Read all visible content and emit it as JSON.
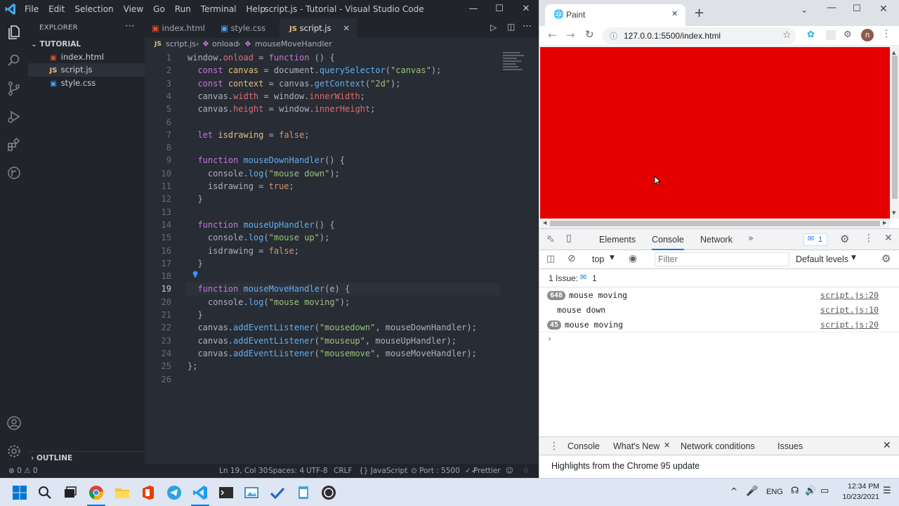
{
  "vscode": {
    "title": "script.js - Tutorial - Visual Studio Code",
    "menu": [
      "File",
      "Edit",
      "Selection",
      "View",
      "Go",
      "Run",
      "Terminal",
      "Help"
    ],
    "explorer": {
      "header": "EXPLORER",
      "folder": "TUTORIAL",
      "files": [
        "index.html",
        "script.js",
        "style.css"
      ],
      "outline": "OUTLINE"
    },
    "tabs": [
      "index.html",
      "style.css",
      "script.js"
    ],
    "breadcrumb": [
      "script.js",
      "onload",
      "mouseMoveHandler"
    ],
    "lines": [
      "window.onload = function () {",
      "  const canvas = document.querySelector(\"canvas\");",
      "  const context = canvas.getContext(\"2d\");",
      "  canvas.width = window.innerWidth;",
      "  canvas.height = window.innerHeight;",
      "",
      "  let isdrawing = false;",
      "",
      "  function mouseDownHandler() {",
      "    console.log(\"mouse down\");",
      "    isdrawing = true;",
      "  }",
      "",
      "  function mouseUpHandler() {",
      "    console.log(\"mouse up\");",
      "    isdrawing = false;",
      "  }",
      "",
      "  function mouseMoveHandler(e) {",
      "    console.log(\"mouse moving\");",
      "  }",
      "  canvas.addEventListener(\"mousedown\", mouseDownHandler);",
      "  canvas.addEventListener(\"mouseup\", mouseUpHandler);",
      "  canvas.addEventListener(\"mousemove\", mouseMoveHandler);",
      "};",
      ""
    ],
    "current_line": 19,
    "status": {
      "problems": "⊗ 0 ⚠ 0",
      "position": "Ln 19, Col 30",
      "spaces": "Spaces: 4",
      "encoding": "UTF-8",
      "eol": "CRLF",
      "language": "{} JavaScript",
      "port": "Port : 5500",
      "prettier": "Prettier"
    }
  },
  "chrome": {
    "tab_title": "Paint",
    "url": "127.0.0.1:5500/index.html",
    "profile_initial": "n",
    "canvas_color": "#e50000",
    "devtools": {
      "tabs": [
        "Elements",
        "Console",
        "Network"
      ],
      "issues_badge": "1",
      "context": "top",
      "filter_placeholder": "Filter",
      "levels": "Default levels",
      "issues_line": "1 Issue:",
      "issues_count": "1",
      "logs": [
        {
          "count": "648",
          "text": "mouse moving",
          "source": "script.js:20"
        },
        {
          "count": "",
          "text": "mouse down",
          "source": "script.js:10"
        },
        {
          "count": "45",
          "text": "mouse moving",
          "source": "script.js:20"
        }
      ],
      "drawer_tabs": [
        "Console",
        "What's New",
        "Network conditions",
        "Issues"
      ],
      "drawer_text": "Highlights from the Chrome 95 update"
    }
  },
  "taskbar": {
    "lang": "ENG",
    "time": "12:34 PM",
    "date": "10/23/2021"
  }
}
